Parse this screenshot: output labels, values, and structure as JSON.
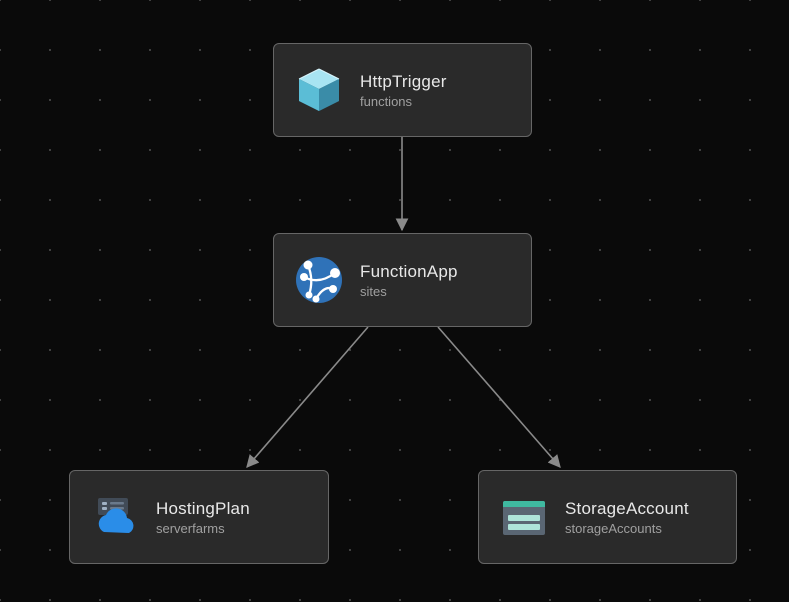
{
  "nodes": {
    "n1": {
      "title": "HttpTrigger",
      "subtitle": "functions"
    },
    "n2": {
      "title": "FunctionApp",
      "subtitle": "sites"
    },
    "n3": {
      "title": "HostingPlan",
      "subtitle": "serverfarms"
    },
    "n4": {
      "title": "StorageAccount",
      "subtitle": "storageAccounts"
    }
  },
  "edges": [
    {
      "from": "n1",
      "to": "n2"
    },
    {
      "from": "n2",
      "to": "n3"
    },
    {
      "from": "n2",
      "to": "n4"
    }
  ],
  "colors": {
    "background": "#0a0a0a",
    "nodeFill": "#2a2a2a",
    "nodeBorder": "#666666",
    "arrow": "#8a8a8a"
  }
}
